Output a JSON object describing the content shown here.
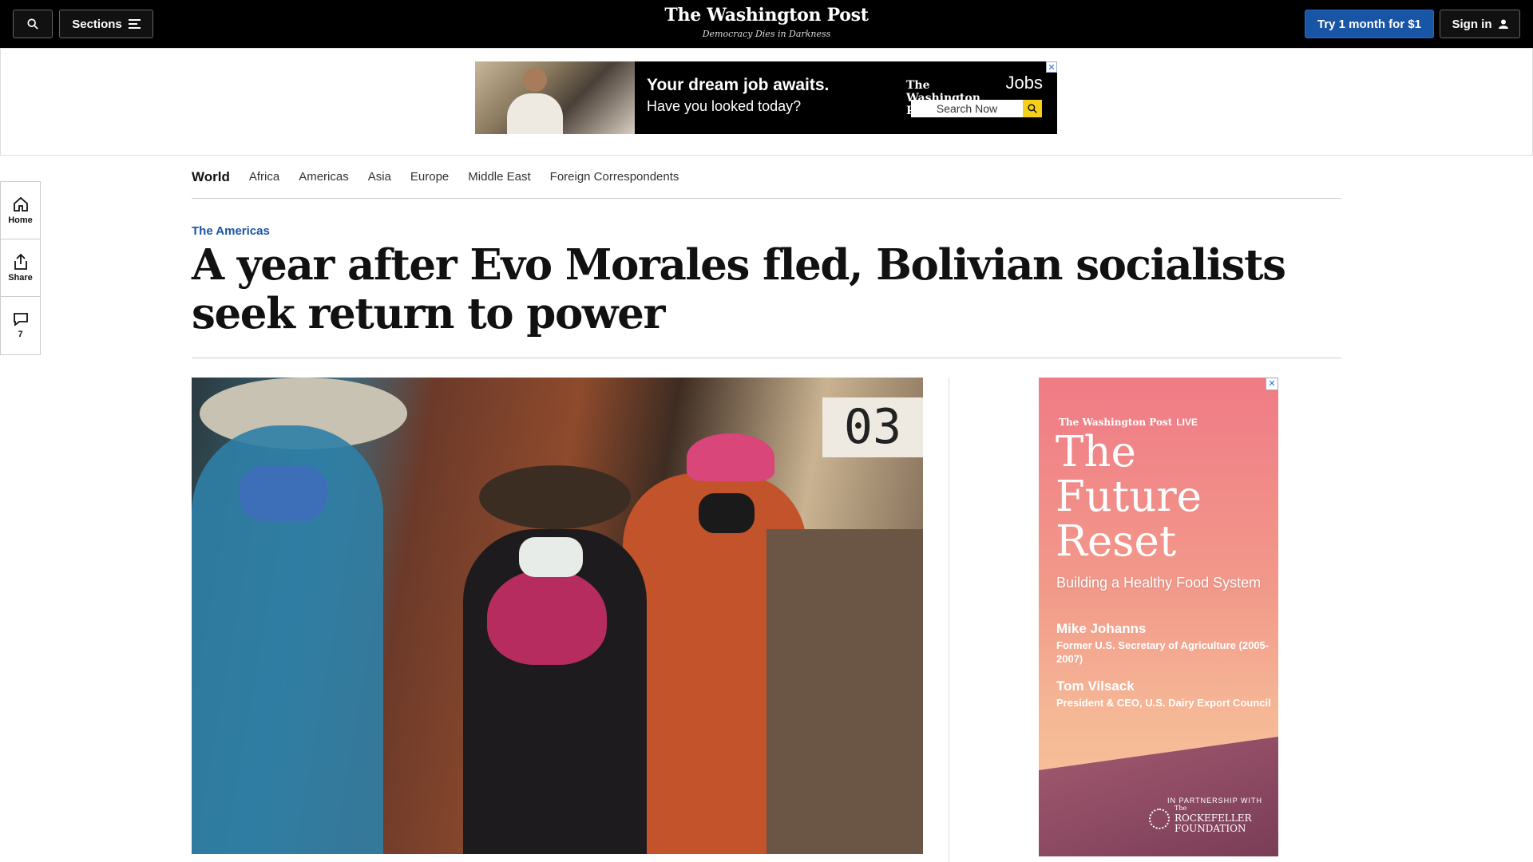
{
  "topbar": {
    "sections_label": "Sections",
    "logo": "The Washington Post",
    "tagline": "Democracy Dies in Darkness",
    "try_label": "Try 1 month for $1",
    "signin_label": "Sign in"
  },
  "top_ad": {
    "headline": "Your dream job awaits.",
    "subline": "Have you looked today?",
    "brand": "The Washington Post",
    "brand_suffix": "Jobs",
    "search_label": "Search Now",
    "close": "✕"
  },
  "rail": {
    "home": "Home",
    "share": "Share",
    "comments": "7"
  },
  "subnav": {
    "current": "World",
    "links": [
      "Africa",
      "Americas",
      "Asia",
      "Europe",
      "Middle East",
      "Foreign Correspondents"
    ]
  },
  "article": {
    "kicker": "The Americas",
    "headline": "A year after Evo Morales fled, Bolivian socialists seek return to power",
    "image_sign": "03"
  },
  "side_ad": {
    "brand": "The Washington Post",
    "brand_suffix": "LIVE",
    "title": "The Future Reset",
    "subtitle": "Building a Healthy Food System",
    "speaker1_name": "Mike Johanns",
    "speaker1_role": "Former U.S. Secretary of Agriculture (2005-2007)",
    "speaker2_name": "Tom Vilsack",
    "speaker2_role": "President & CEO, U.S. Dairy Export Council",
    "partner_label": "IN PARTNERSHIP WITH",
    "partner_prefix": "The",
    "partner_name": "ROCKEFELLER FOUNDATION",
    "close": "✕"
  },
  "colors": {
    "accent_blue": "#1955a5",
    "topbar_bg": "#000000",
    "ad_gold": "#f6cf1a"
  }
}
